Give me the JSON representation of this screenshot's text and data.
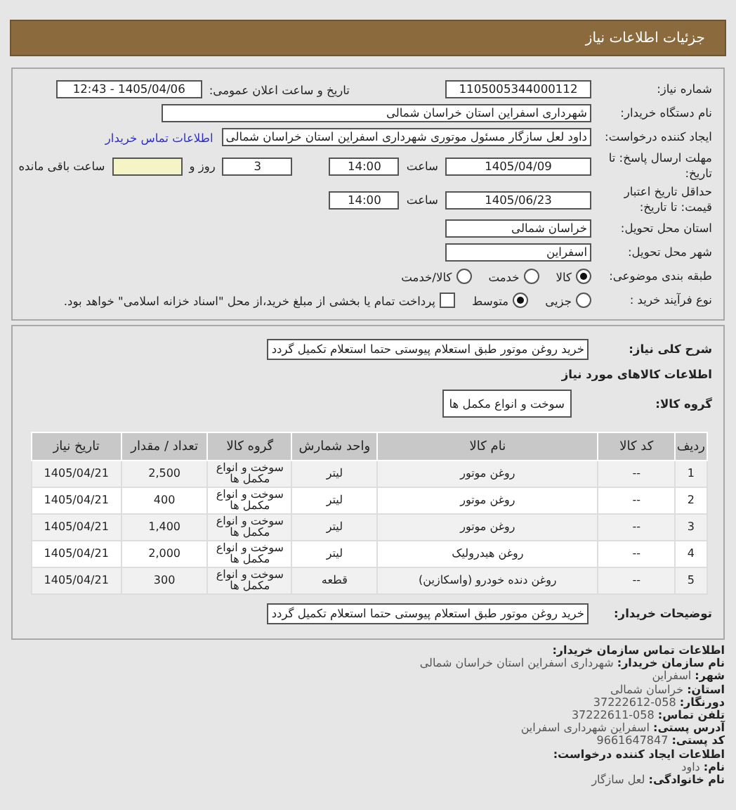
{
  "header": {
    "title": "جزئیات اطلاعات نیاز"
  },
  "details": {
    "need_number": {
      "label": "شماره نیاز:",
      "value": "1105005344000112"
    },
    "announce": {
      "label": "تاریخ و ساعت اعلان عمومی:",
      "value": "1405/04/06 - 12:43"
    },
    "buyer": {
      "label": "نام دستگاه خریدار:",
      "value": "شهرداری اسفراین استان خراسان شمالی"
    },
    "creator": {
      "label": "ایجاد کننده درخواست:",
      "value": "داود لعل سازگار مسئول موتوری شهرداری اسفراین استان خراسان شمالی",
      "link": "اطلاعات تماس خریدار"
    },
    "deadline": {
      "label": "مهلت ارسال پاسخ: تا تاریخ:",
      "date": "1405/04/09",
      "time_label": "ساعت",
      "time": "14:00",
      "days": "3",
      "days_label": "روز و",
      "remaining_label": "ساعت باقی مانده"
    },
    "validity": {
      "label": "حداقل تاریخ اعتبار قیمت: تا تاریخ:",
      "date": "1405/06/23",
      "time_label": "ساعت",
      "time": "14:00"
    },
    "province": {
      "label": "استان محل تحویل:",
      "value": "خراسان شمالی"
    },
    "city": {
      "label": "شهر محل تحویل:",
      "value": "اسفراین"
    },
    "category": {
      "label": "طبقه بندی موضوعی:",
      "options": [
        {
          "label": "کالا",
          "selected": true
        },
        {
          "label": "خدمت",
          "selected": false
        },
        {
          "label": "کالا/خدمت",
          "selected": false
        }
      ]
    },
    "process": {
      "label": "نوع فرآیند خرید :",
      "options": [
        {
          "label": "جزیی",
          "selected": false
        },
        {
          "label": "متوسط",
          "selected": true
        }
      ],
      "payment": {
        "checked": false,
        "text": "پرداخت تمام یا بخشی از مبلغ خرید،از محل \"اسناد خزانه اسلامی\" خواهد بود."
      }
    }
  },
  "goods": {
    "summary": {
      "label": "شرح کلی نیاز:",
      "value": "خرید روغن موتور طبق استعلام پیوستی حتما استعلام تکمیل گردد"
    },
    "heading": "اطلاعات کالاهای مورد نیاز",
    "group": {
      "label": "گروه کالا:",
      "value": "سوخت و انواع مکمل ها"
    },
    "table": {
      "columns": [
        "ردیف",
        "کد کالا",
        "نام کالا",
        "واحد شمارش",
        "گروه کالا",
        "تعداد / مقدار",
        "تاریخ نیاز"
      ],
      "rows": [
        [
          "1",
          "--",
          "روغن موتور",
          "لیتر",
          "سوخت و انواع مکمل ها",
          "2,500",
          "1405/04/21"
        ],
        [
          "2",
          "--",
          "روغن موتور",
          "لیتر",
          "سوخت و انواع مکمل ها",
          "400",
          "1405/04/21"
        ],
        [
          "3",
          "--",
          "روغن موتور",
          "لیتر",
          "سوخت و انواع مکمل ها",
          "1,400",
          "1405/04/21"
        ],
        [
          "4",
          "--",
          "روغن هیدرولیک",
          "لیتر",
          "سوخت و انواع مکمل ها",
          "2,000",
          "1405/04/21"
        ],
        [
          "5",
          "--",
          "روغن دنده خودرو (واسکازین)",
          "قطعه",
          "سوخت و انواع مکمل ها",
          "300",
          "1405/04/21"
        ]
      ]
    },
    "notes": {
      "label": "توضیحات خریدار:",
      "value": "خرید روغن موتور طبق استعلام پیوستی حتما استعلام تکمیل گردد"
    }
  },
  "contact": [
    {
      "kind": "heading",
      "label": "اطلاعات تماس سازمان خریدار:"
    },
    {
      "kind": "field",
      "label": "نام سازمان خریدار:",
      "value": "شهرداری اسفراین استان خراسان شمالی"
    },
    {
      "kind": "field",
      "label": "شهر:",
      "value": "اسفراین"
    },
    {
      "kind": "field",
      "label": "استان:",
      "value": "خراسان شمالی"
    },
    {
      "kind": "field",
      "label": "دورنگار:",
      "value": "058-37222612"
    },
    {
      "kind": "field",
      "label": "تلفن تماس:",
      "value": "058-37222611"
    },
    {
      "kind": "field",
      "label": "آدرس پستی:",
      "value": "اسفراین شهرداری اسفراین"
    },
    {
      "kind": "field",
      "label": "کد پستی:",
      "value": "9661647847"
    },
    {
      "kind": "heading",
      "label": "اطلاعات ایجاد کننده درخواست:"
    },
    {
      "kind": "field",
      "label": "نام:",
      "value": "داود"
    },
    {
      "kind": "field",
      "label": "نام خانوادگی:",
      "value": "لعل سازگار"
    }
  ]
}
